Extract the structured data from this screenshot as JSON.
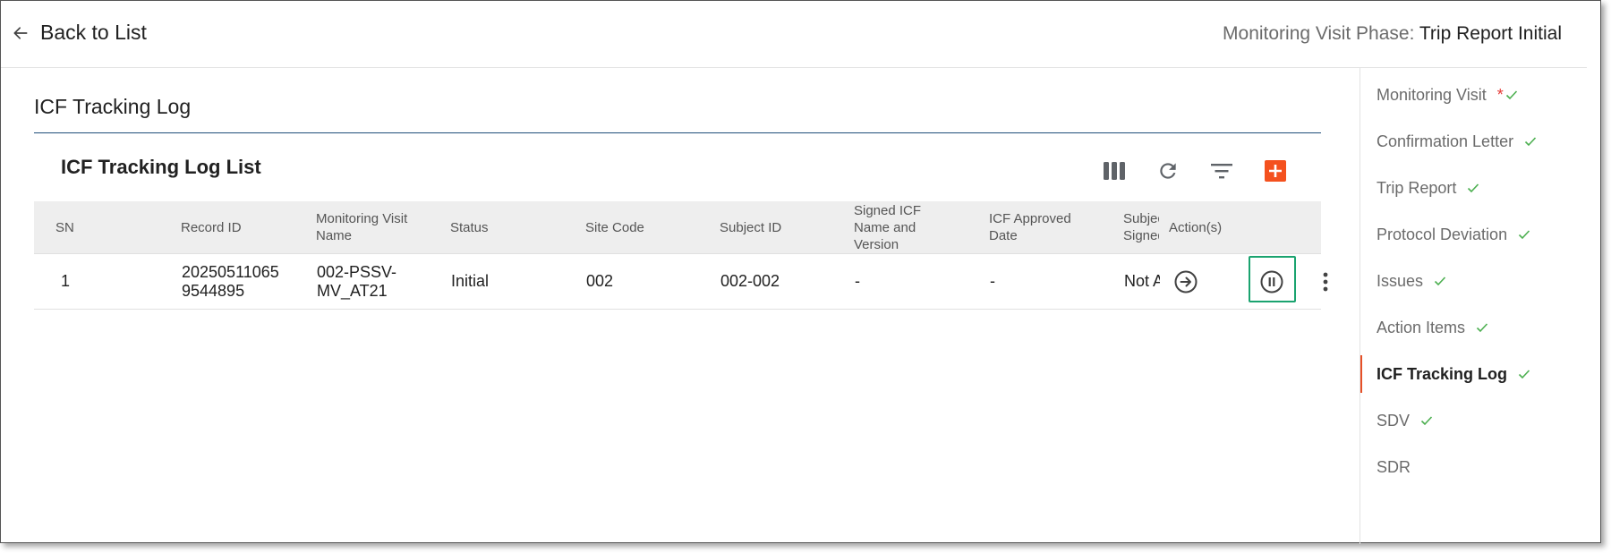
{
  "header": {
    "back_label": "Back to List",
    "phase_label": "Monitoring Visit Phase:",
    "phase_value": "Trip Report Initial"
  },
  "page": {
    "title": "ICF Tracking Log",
    "list_title": "ICF Tracking Log List"
  },
  "toolbar": {
    "icons": [
      "columns-icon",
      "refresh-icon",
      "filter-icon",
      "add-icon"
    ],
    "accent": "#f4511e"
  },
  "table": {
    "columns": [
      "SN",
      "Record ID",
      "Monitoring Visit Name",
      "Status",
      "Site Code",
      "Subject ID",
      "Signed ICF Name and Version",
      "ICF Approved Date",
      "Subject Signed",
      "Action(s)"
    ],
    "rows": [
      {
        "sn": "1",
        "record_id": "20250511065 9544895",
        "visit_name": "002-PSSV-MV_AT21",
        "status": "Initial",
        "site_code": "002",
        "subject_id": "002-002",
        "signed_icf": "-",
        "approved_date": "-",
        "subject_signed": "Not Applicable"
      }
    ],
    "row_actions": [
      "arrow-right-circle-icon",
      "pause-circle-icon",
      "more-vertical-icon"
    ],
    "highlight_color": "#1aa36f"
  },
  "sidebar": {
    "items": [
      {
        "label": "Monitoring Visit",
        "required": "*",
        "checked": true
      },
      {
        "label": "Confirmation Letter",
        "checked": true
      },
      {
        "label": "Trip Report",
        "checked": true
      },
      {
        "label": "Protocol Deviation",
        "checked": true
      },
      {
        "label": "Issues",
        "checked": true
      },
      {
        "label": "Action Items",
        "checked": true
      },
      {
        "label": "ICF Tracking Log",
        "checked": true,
        "active": true
      },
      {
        "label": "SDV",
        "checked": true
      },
      {
        "label": "SDR",
        "checked": false
      }
    ],
    "active_color": "#e65027",
    "check_color": "#4caf50"
  }
}
